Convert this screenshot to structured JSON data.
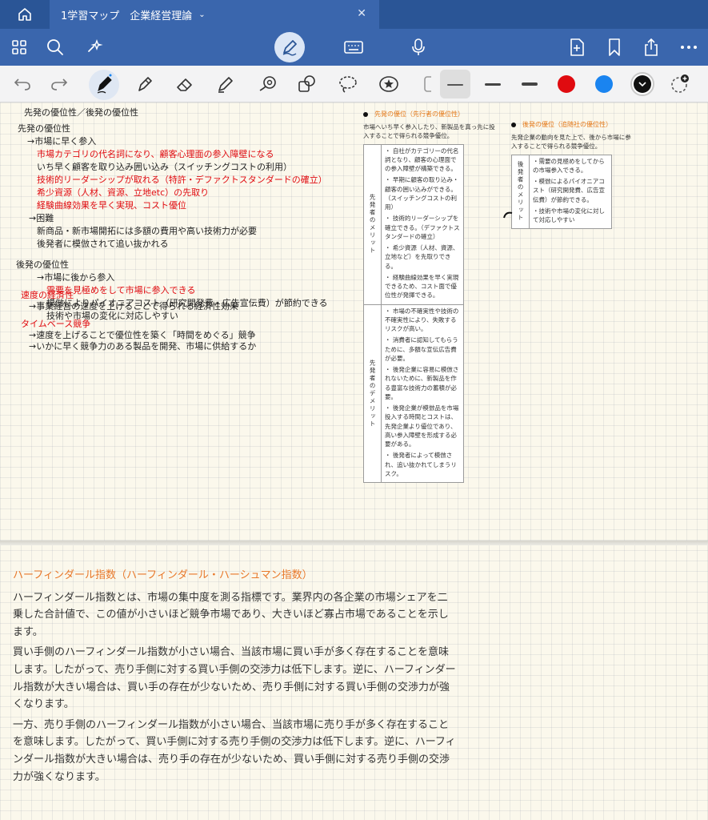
{
  "tab": {
    "title": "1学習マップ　企業経営理論"
  },
  "icons": [
    "home-icon",
    "chevron-down-icon",
    "close-icon",
    "grid-icon",
    "search-icon",
    "sparkle-icon",
    "pen-mode-icon",
    "keyboard-icon",
    "microphone-icon",
    "add-page-icon",
    "bookmark-icon",
    "share-icon",
    "more-icon",
    "undo-icon",
    "redo-icon",
    "pen-icon",
    "pencil-icon",
    "eraser-icon",
    "highlighter-icon",
    "lasso-icon",
    "shapes-icon",
    "lasso-select-icon",
    "sticker-icon"
  ],
  "colors": {
    "red": "#e00b10",
    "blue": "#1a84f0",
    "black": "#111111",
    "accent": "#3a66ad"
  },
  "handwriting": {
    "l0": "先発の優位性／後発の優位性",
    "l1": "先発の優位性",
    "l2": "→市場に早く参入",
    "l3": "市場カテゴリの代名詞になり、顧客心理面の参入障壁になる",
    "l4": "いち早く顧客を取り込み囲い込み（スイッチングコストの利用）",
    "l5": "技術的リーダーシップが取れる（特許・デファクトスタンダードの確立）",
    "l6": "希少資源（人材、資源、立地etc）の先取り",
    "l7": "経験曲線効果を早く実現、コスト優位",
    "l8": "→困難",
    "l9": "新商品・新市場開拓には多額の費用や高い技術力が必要",
    "l10": "後発者に模倣されて追い抜かれる",
    "l11": "後発の優位性",
    "l12": "→市場に後から参入",
    "l13": "需要を見極めをして市場に参入できる",
    "l14": "模倣によりパイオニアコスト（研究開発費・広告宣伝費）が節約できる",
    "l15": "技術や市場の変化に対応しやすい",
    "l16": "速度の経済性",
    "l17": "→事業経営の速度を上げることで得られる経済性効果",
    "l18": "タイムベース競争",
    "l19": "→速度を上げることで優位性を築く「時間をめぐる」競争",
    "l20": "→いかに早く競争力のある製品を開発、市場に供給するか"
  },
  "first_mover": {
    "title": "先発の優位（先行者の優位性）",
    "intro": "市場へいち早く参入したり、新製品を真っ先に投入することで得られる競争優位。",
    "merit_label": "先発者のメリット",
    "merits": [
      "・ 自社がカテゴリーの代名詞となり、顧客の心理面での参入障壁が構築できる。",
      "・ 早期に顧客の取り込み・顧客の囲い込みができる。（スイッチングコストの利用）",
      "・ 技術的リーダーシップを確立できる。（デファクトスタンダードの確立）",
      "・ 希少資源（人材、資源、立地など）を先取りできる。",
      "・ 経験曲線効果を早く実現できるため、コスト面で優位性が発揮できる。"
    ],
    "demerit_label": "先発者のデメリット",
    "demerits": [
      "・ 市場の不確実性や技術の不確実性により、失敗するリスクが高い。",
      "・ 消費者に認知してもらうために、多額な宣伝広告費が必要。",
      "・ 後発企業に容易に模倣されないために、新製品を作る豊富な技術力の蓄積が必要。",
      "・ 後発企業が模倣品を市場投入する時間とコストは、先発企業より優位であり、高い参入障壁を形成する必要がある。",
      "・ 後発者によって模倣され、追い抜かれてしまうリスク。"
    ]
  },
  "second_mover": {
    "title": "後発の優位（追随社の優位性）",
    "intro": "先発企業の動向を見た上で、後から市場に参入することで得られる競争優位。",
    "merit_label": "後発者のメリット",
    "merits": [
      "・需要の見極めをしてからの市場参入できる。",
      "・模倣によるパイオニアコスト（研究開発費、広告宣伝費）が節約できる。",
      "・技術や市場の変化に対して対応しやすい"
    ]
  },
  "typed": {
    "heading": "ハーフィンダール指数（ハーフィンダール・ハーシュマン指数）",
    "p1": "ハーフィンダール指数とは、市場の集中度を測る指標です。業界内の各企業の市場シェアを二乗した合計値で、この値が小さいほど競争市場であり、大きいほど寡占市場であることを示します。",
    "p2": "買い手側のハーフィンダール指数が小さい場合、当該市場に買い手が多く存在することを意味します。したがって、売り手側に対する買い手側の交渉力は低下します。逆に、ハーフィンダール指数が大きい場合は、買い手の存在が少ないため、売り手側に対する買い手側の交渉力が強くなります。",
    "p3": "一方、売り手側のハーフィンダール指数が小さい場合、当該市場に売り手が多く存在することを意味します。したがって、買い手側に対する売り手側の交渉力は低下します。逆に、ハーフィンダール指数が大きい場合は、売り手の存在が少ないため、買い手側に対する売り手側の交渉力が強くなります。"
  }
}
